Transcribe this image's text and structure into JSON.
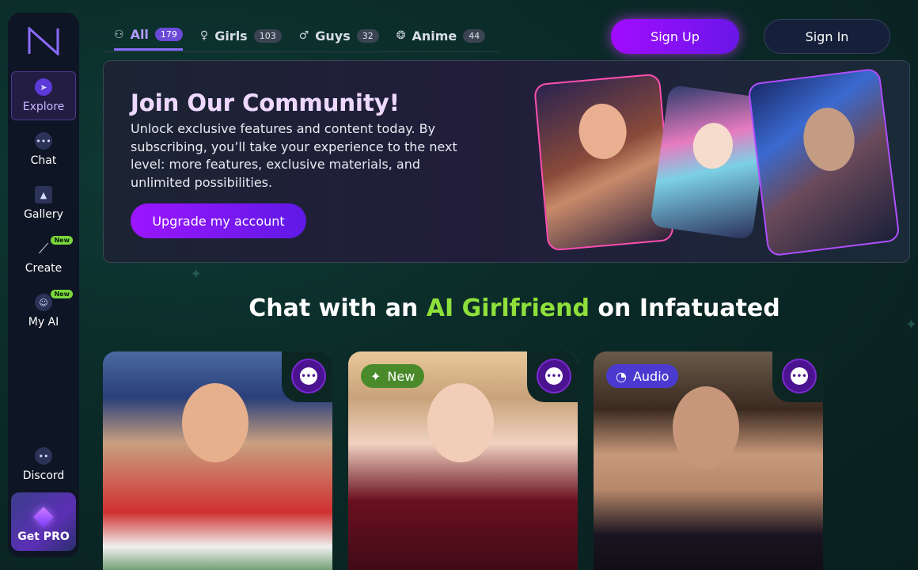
{
  "sidebar": {
    "items": [
      {
        "label": "Explore",
        "icon": "compass-icon",
        "active": true
      },
      {
        "label": "Chat",
        "icon": "chat-bubble-icon"
      },
      {
        "label": "Gallery",
        "icon": "image-icon"
      },
      {
        "label": "Create",
        "icon": "magic-wand-icon",
        "badge": "New"
      },
      {
        "label": "My AI",
        "icon": "face-sparkle-icon",
        "badge": "New"
      }
    ],
    "discord_label": "Discord",
    "pro_label": "Get PRO"
  },
  "tabs": [
    {
      "label": "All",
      "count": "179",
      "icon": "people-icon",
      "active": true
    },
    {
      "label": "Girls",
      "count": "103",
      "icon": "female-icon"
    },
    {
      "label": "Guys",
      "count": "32",
      "icon": "male-icon"
    },
    {
      "label": "Anime",
      "count": "44",
      "icon": "anime-icon"
    }
  ],
  "header": {
    "signup_label": "Sign Up",
    "signin_label": "Sign In"
  },
  "banner": {
    "title": "Join Our Community!",
    "text": "Unlock exclusive features and content today. By subscribing, you’ll take your experience to the next level: more features, exclusive materials, and unlimited possibilities.",
    "cta_label": "Upgrade my account"
  },
  "section": {
    "heading_pre": "Chat with an ",
    "heading_accent": "AI Girlfriend",
    "heading_post": " on Infatuated"
  },
  "cards": [
    {
      "badge": ""
    },
    {
      "badge": "New"
    },
    {
      "badge": "Audio"
    }
  ],
  "colors": {
    "accent_purple": "#8a6cff",
    "accent_green": "#8ee03a",
    "brand_gradient_start": "#a10cff"
  }
}
